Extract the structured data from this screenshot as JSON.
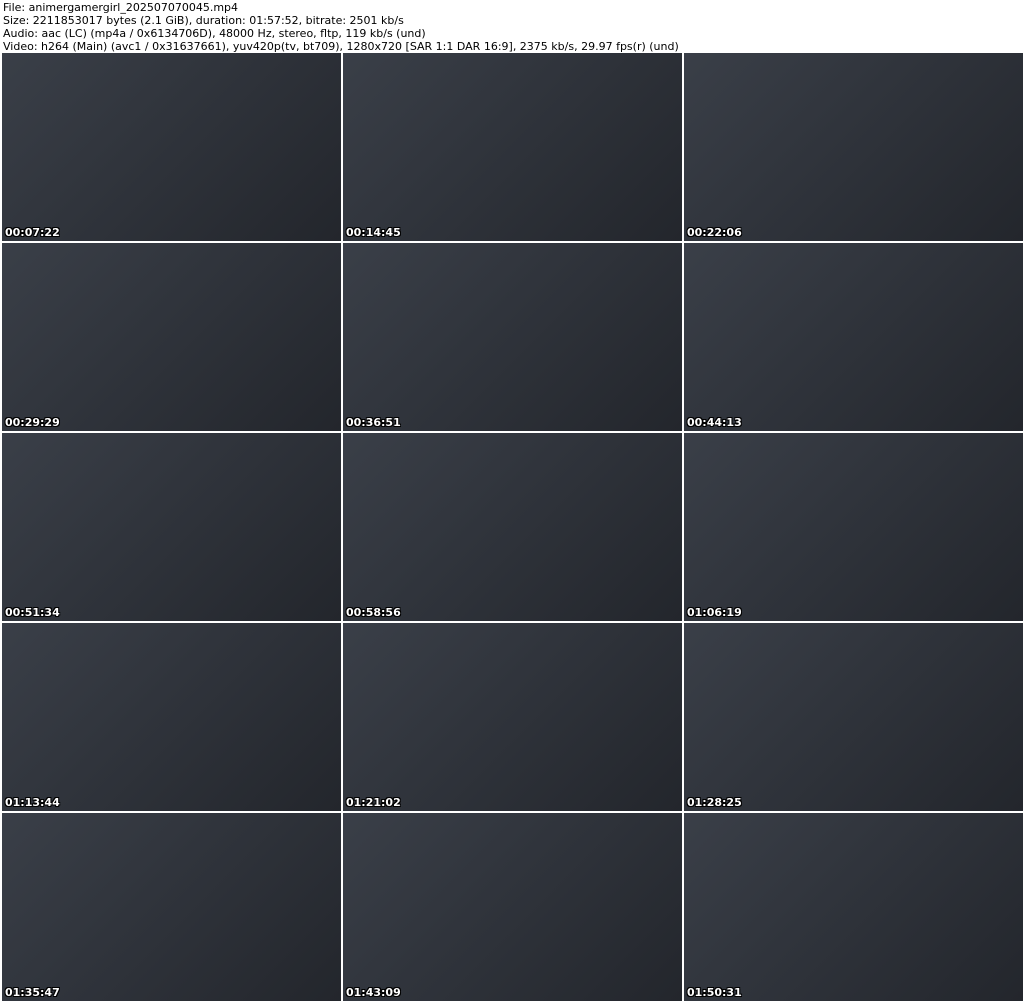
{
  "header": {
    "file": "File: animergamergirl_202507070045.mp4",
    "size": "Size: 2211853017 bytes (2.1 GiB), duration: 01:57:52, bitrate: 2501 kb/s",
    "audio": "Audio: aac (LC) (mp4a / 0x6134706D), 48000 Hz, stereo, fltp, 119 kb/s (und)",
    "video": "Video: h264 (Main) (avc1 / 0x31637661), yuv420p(tv, bt709), 1280x720 [SAR 1:1 DAR 16:9], 2375 kb/s, 29.97 fps(r) (und)"
  },
  "thumbnails": [
    {
      "timestamp": "00:07:22"
    },
    {
      "timestamp": "00:14:45"
    },
    {
      "timestamp": "00:22:06"
    },
    {
      "timestamp": "00:29:29"
    },
    {
      "timestamp": "00:36:51"
    },
    {
      "timestamp": "00:44:13"
    },
    {
      "timestamp": "00:51:34"
    },
    {
      "timestamp": "00:58:56"
    },
    {
      "timestamp": "01:06:19"
    },
    {
      "timestamp": "01:13:44"
    },
    {
      "timestamp": "01:21:02"
    },
    {
      "timestamp": "01:28:25"
    },
    {
      "timestamp": "01:35:47"
    },
    {
      "timestamp": "01:43:09"
    },
    {
      "timestamp": "01:50:31"
    }
  ]
}
